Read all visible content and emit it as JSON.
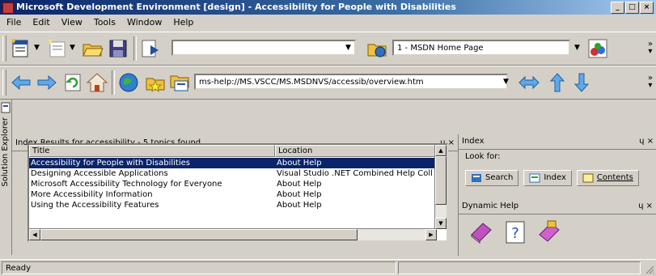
{
  "window": {
    "title": "Microsoft Development Environment [design] - Accessibility for People with Disabilities",
    "buttons": [
      "_",
      "□",
      "×"
    ]
  },
  "menubar": [
    "File",
    "Edit",
    "View",
    "Tools",
    "Window",
    "Help"
  ],
  "toolbar1": {
    "combo_blank": "",
    "combo_project": "1 - MSDN Home Page",
    "chevron": "»"
  },
  "toolbar2": {
    "url_combo": "ms-help://MS.VSCC/MS.MSDNVS/accessib/overview.htm",
    "chevron": "»"
  },
  "left_strip": {
    "label": "Solution Explorer"
  },
  "index_results": {
    "title": "Index Results for accessibility - 5 topics found",
    "controls": "ɥ ×",
    "columns": [
      "Title",
      "Location"
    ],
    "rows": [
      {
        "title": "Accessibility for People with Disabilities",
        "location": "About Help",
        "selected": true
      },
      {
        "title": "Designing Accessible Applications",
        "location": "Visual Studio .NET Combined Help Coll",
        "selected": false
      },
      {
        "title": "Microsoft Accessibility Technology for Everyone",
        "location": "About Help",
        "selected": false
      },
      {
        "title": "More Accessibility Information",
        "location": "About Help",
        "selected": false
      },
      {
        "title": "Using the Accessibility Features",
        "location": "About Help",
        "selected": false
      }
    ]
  },
  "index_panel": {
    "title": "Index",
    "label": "Look for:",
    "controls": "ɥ ×",
    "tabs": [
      {
        "label": "Search",
        "icon": "search-tab-icon"
      },
      {
        "label": "Index",
        "icon": "index-tab-icon"
      },
      {
        "label": "Contents",
        "icon": "contents-tab-icon"
      }
    ]
  },
  "dynamic_help": {
    "title": "Dynamic Help",
    "controls": "ɥ ×"
  },
  "status": {
    "text": "Ready"
  }
}
